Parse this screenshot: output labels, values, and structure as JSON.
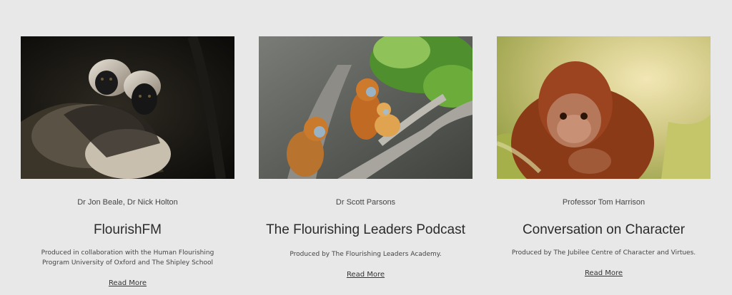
{
  "cards": [
    {
      "image_alt": "Two cotton-top tamarins on a dark background",
      "authors": "Dr Jon Beale, Dr Nick Holton",
      "title": "FlourishFM",
      "description": "Produced  in collaboration with the Human Flourishing Program University of Oxford and The Shipley School",
      "link": "Read More"
    },
    {
      "image_alt": "Golden snub-nosed monkeys on a tree branch",
      "authors": "Dr Scott Parsons",
      "title": "The Flourishing Leaders Podcast",
      "description": "Produced by The Flourishing Leaders Academy.",
      "link": "Read More"
    },
    {
      "image_alt": "Young orangutan among green grass",
      "authors": "Professor Tom Harrison",
      "title": "Conversation on Character",
      "description": "Produced by The Jubilee Centre of Character and Virtues.",
      "link": "Read More"
    }
  ]
}
